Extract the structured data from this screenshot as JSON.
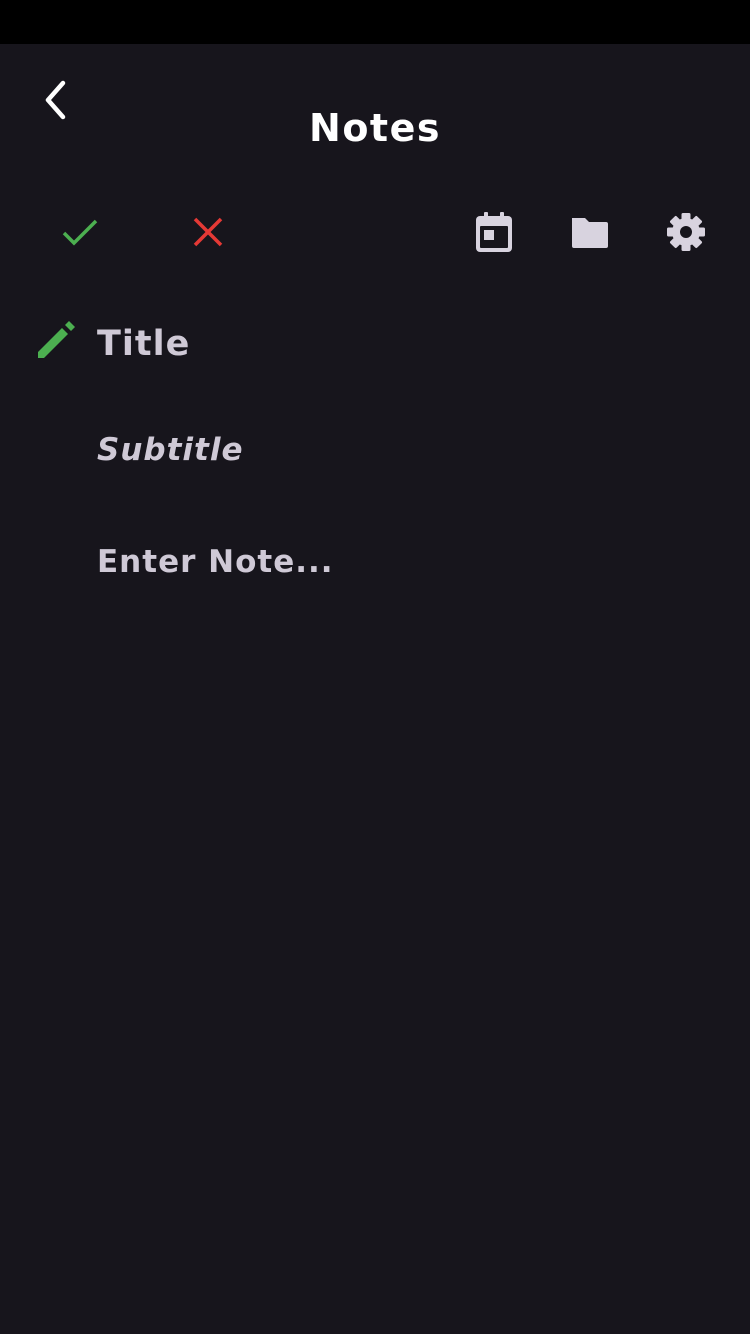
{
  "header": {
    "title": "Notes",
    "back_icon": "chevron-left-icon"
  },
  "toolbar": {
    "confirm_icon": "check-icon",
    "cancel_icon": "close-icon",
    "calendar_icon": "calendar-icon",
    "folder_icon": "folder-icon",
    "settings_icon": "gear-icon"
  },
  "editor": {
    "title_placeholder": "Title",
    "subtitle_placeholder": "Subtitle",
    "note_placeholder": "Enter Note...",
    "edit_icon": "pencil-icon"
  },
  "colors": {
    "background": "#17151c",
    "status_bar": "#000000",
    "accent_green": "#4caf50",
    "accent_red": "#e53935",
    "icon_light": "#d8d3df",
    "placeholder_text": "#cfc9d6",
    "title_text": "#ffffff"
  }
}
